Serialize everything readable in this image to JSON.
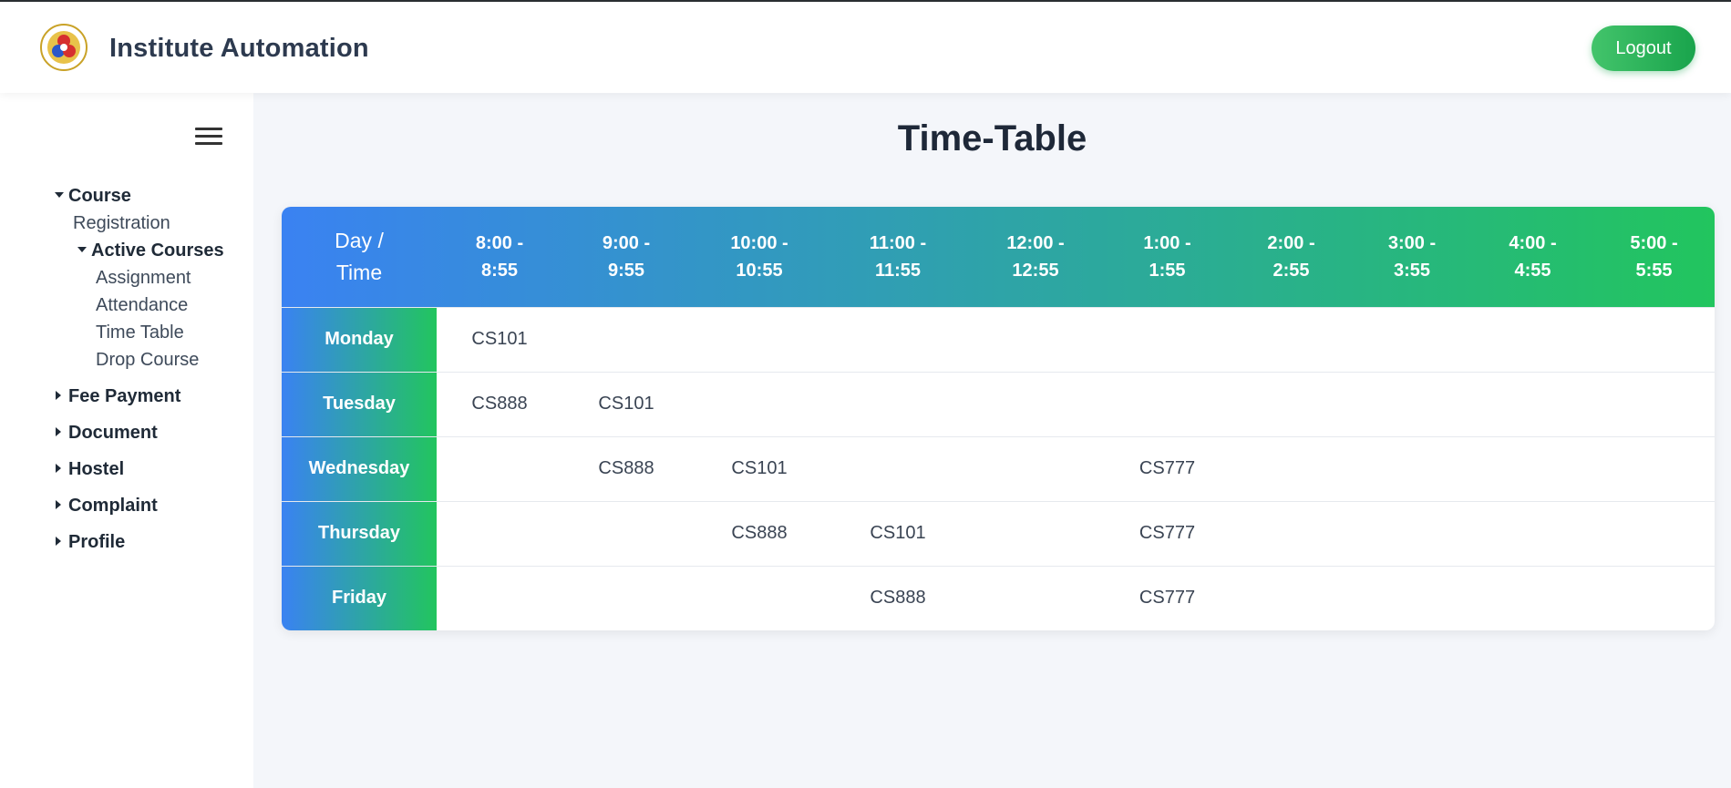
{
  "header": {
    "app_title": "Institute Automation",
    "logout_label": "Logout",
    "logo_icon": "institute-emblem"
  },
  "sidebar": {
    "menu_icon": "hamburger-icon",
    "items": [
      {
        "label": "Course",
        "expanded": true
      },
      {
        "label": "Registration"
      },
      {
        "label": "Active Courses",
        "expanded": true
      },
      {
        "label": "Assignment"
      },
      {
        "label": "Attendance"
      },
      {
        "label": "Time Table"
      },
      {
        "label": "Drop Course"
      },
      {
        "label": "Fee Payment",
        "expanded": false
      },
      {
        "label": "Document",
        "expanded": false
      },
      {
        "label": "Hostel",
        "expanded": false
      },
      {
        "label": "Complaint",
        "expanded": false
      },
      {
        "label": "Profile",
        "expanded": false
      }
    ]
  },
  "main": {
    "title": "Time-Table",
    "timetable": {
      "corner": [
        "Day /",
        "Time"
      ],
      "slots": [
        [
          "8:00 -",
          "8:55"
        ],
        [
          "9:00 -",
          "9:55"
        ],
        [
          "10:00 -",
          "10:55"
        ],
        [
          "11:00 -",
          "11:55"
        ],
        [
          "12:00 -",
          "12:55"
        ],
        [
          "1:00 -",
          "1:55"
        ],
        [
          "2:00 -",
          "2:55"
        ],
        [
          "3:00 -",
          "3:55"
        ],
        [
          "4:00 -",
          "4:55"
        ],
        [
          "5:00 -",
          "5:55"
        ]
      ],
      "rows": [
        {
          "day": "Monday",
          "cells": [
            "CS101",
            "",
            "",
            "",
            "",
            "",
            "",
            "",
            "",
            ""
          ]
        },
        {
          "day": "Tuesday",
          "cells": [
            "CS888",
            "CS101",
            "",
            "",
            "",
            "",
            "",
            "",
            "",
            ""
          ]
        },
        {
          "day": "Wednesday",
          "cells": [
            "",
            "CS888",
            "CS101",
            "",
            "",
            "CS777",
            "",
            "",
            "",
            ""
          ]
        },
        {
          "day": "Thursday",
          "cells": [
            "",
            "",
            "CS888",
            "CS101",
            "",
            "CS777",
            "",
            "",
            "",
            ""
          ]
        },
        {
          "day": "Friday",
          "cells": [
            "",
            "",
            "",
            "CS888",
            "",
            "CS777",
            "",
            "",
            "",
            ""
          ]
        }
      ]
    }
  },
  "colors": {
    "accent_blue": "#3a82f2",
    "accent_green": "#22c55e",
    "logout_green": "#19a44c"
  }
}
